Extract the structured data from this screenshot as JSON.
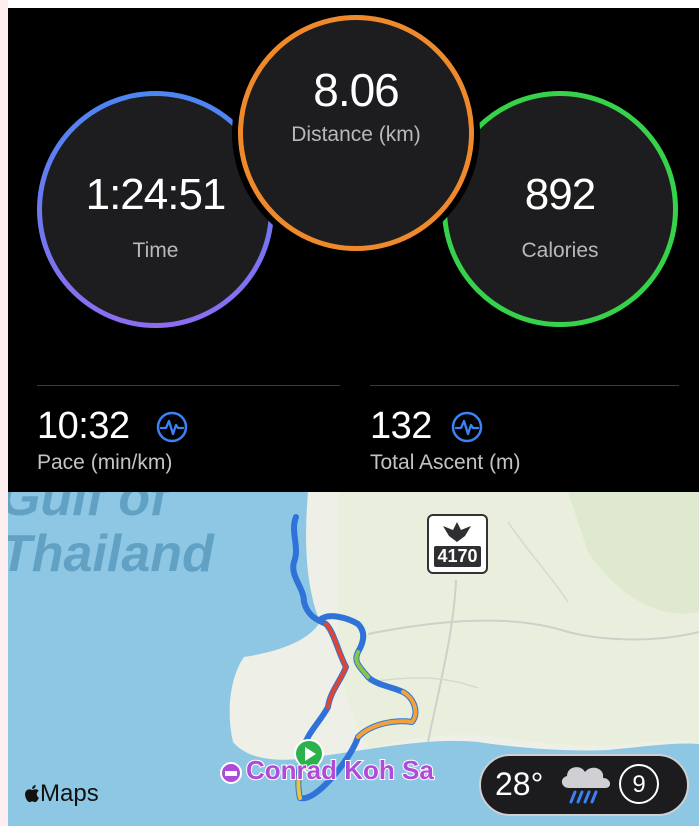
{
  "summary": {
    "time": {
      "value": "1:24:51",
      "label": "Time"
    },
    "distance": {
      "value": "8.06",
      "label": "Distance (km)"
    },
    "calories": {
      "value": "892",
      "label": "Calories"
    }
  },
  "metrics": {
    "pace": {
      "value": "10:32",
      "label": "Pace (min/km)",
      "icon": "heart-rate-wave-icon"
    },
    "ascent": {
      "value": "132",
      "label": "Total Ascent (m)",
      "icon": "heart-rate-wave-icon"
    }
  },
  "map": {
    "water_label_line1": "Gulf of",
    "water_label_line2": "Thailand",
    "road_shield": "4170",
    "poi_label": "Conrad Koh Sa",
    "provider": "Maps",
    "weather_temp": "28°",
    "weather_icon": "rain-cloud-icon",
    "aqi": "9"
  },
  "colors": {
    "time_ring": "#4b86f2",
    "distance_ring": "#ef8a2c",
    "calories_ring": "#35d24a",
    "accent_icon": "#3b82f6",
    "route": "#2f73d8",
    "water": "#8dc7e3"
  }
}
